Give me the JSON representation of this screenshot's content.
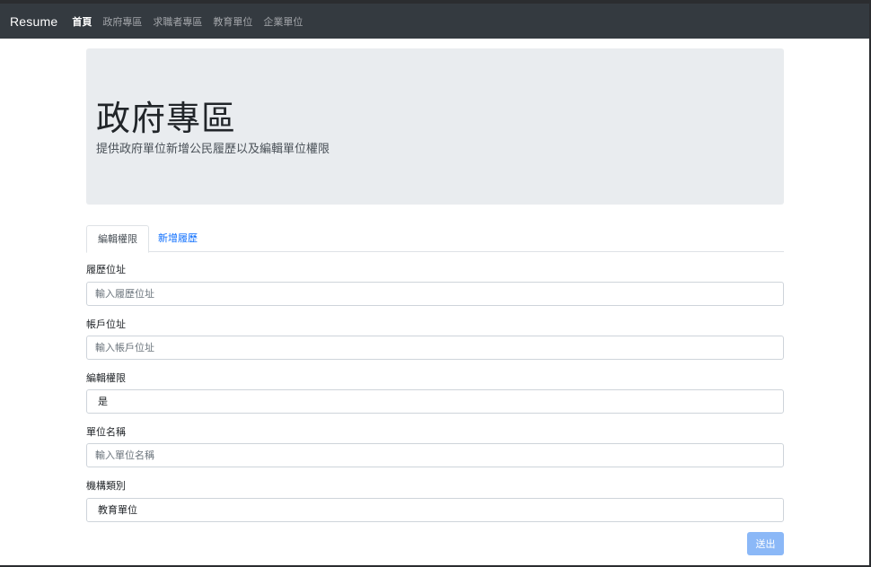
{
  "nav": {
    "brand": "Resume",
    "links": [
      "首頁",
      "政府專區",
      "求職者專區",
      "教育單位",
      "企業單位"
    ]
  },
  "jumbotron": {
    "title": "政府專區",
    "lead": "提供政府單位新增公民履歷以及編輯單位權限"
  },
  "tabs": [
    "編輯權限",
    "新增履歷"
  ],
  "form": {
    "resume_address": {
      "label": "履歷位址",
      "placeholder": "輸入履歷位址"
    },
    "account_address": {
      "label": "帳戶位址",
      "placeholder": "輸入帳戶位址"
    },
    "edit_permission": {
      "label": "編輯權限",
      "value": "是"
    },
    "unit_name": {
      "label": "單位名稱",
      "placeholder": "輸入單位名稱"
    },
    "institution_type": {
      "label": "機構類別",
      "value": "教育單位"
    },
    "submit_label": "送出"
  },
  "colors": {
    "navbar": "#343a40",
    "jumbotron": "#e9ecef",
    "link": "#0d6efd",
    "submit": "#8bb8f7"
  }
}
